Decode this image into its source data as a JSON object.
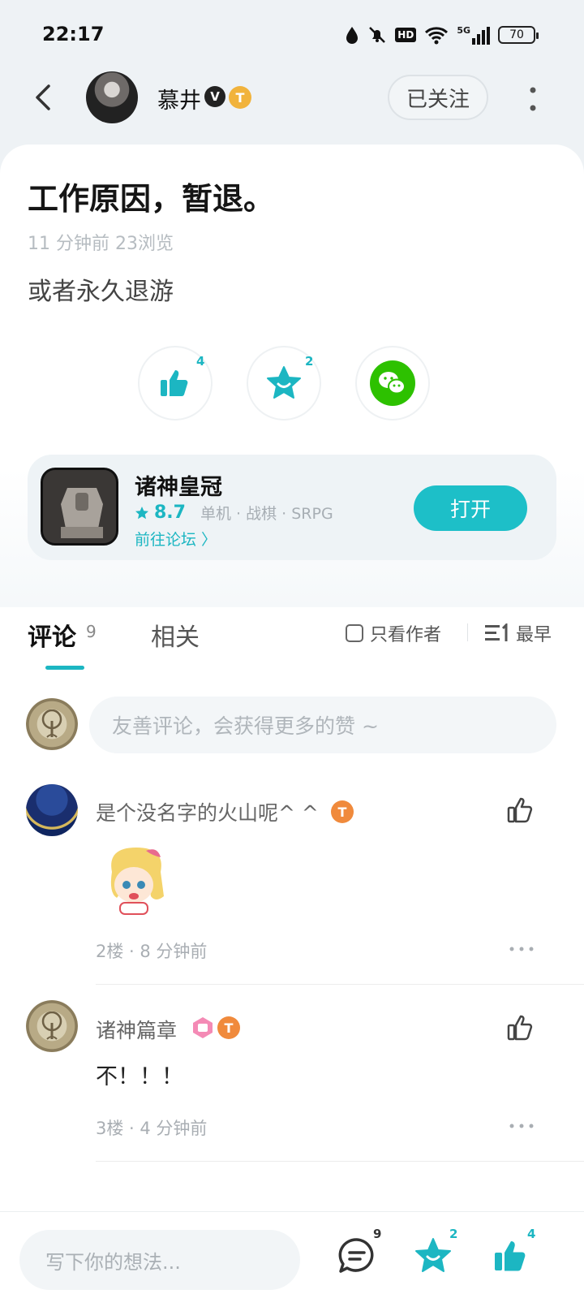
{
  "status": {
    "time": "22:17",
    "network": "5G",
    "hd_label": "HD",
    "battery": "70"
  },
  "header": {
    "author_name": "慕井",
    "verified_badge": "V",
    "level_badge": "T",
    "follow_label": "已关注"
  },
  "post": {
    "title": "工作原因，暂退。",
    "meta": "11 分钟前   23浏览",
    "body": "或者永久退游",
    "like_count": "4",
    "favorite_count": "2"
  },
  "game": {
    "name": "诸神皇冠",
    "score": "8.7",
    "tags": "单机 · 战棋 · SRPG",
    "forum_link": "前往论坛 〉",
    "open_label": "打开"
  },
  "comments_section": {
    "tab_comments": "评论",
    "comment_count": "9",
    "tab_related": "相关",
    "author_only_label": "只看作者",
    "sort_label": "最早",
    "input_placeholder": "友善评论，会获得更多的赞 ~",
    "items": [
      {
        "username": "是个没名字的火山呢^ ^",
        "level_badge": "T",
        "meta": "2楼 · 8 分钟前"
      },
      {
        "username": "诸神篇章",
        "level_badge": "T",
        "text": "不！！！",
        "meta": "3楼 · 4 分钟前"
      }
    ]
  },
  "bottom_bar": {
    "input_placeholder": "写下你的想法...",
    "comment_count": "9",
    "favorite_count": "2",
    "like_count": "4"
  },
  "colors": {
    "accent": "#1cb6c2",
    "badge_orange": "#f08a3c",
    "badge_gold": "#f1b33c",
    "wechat_green": "#2dc100"
  }
}
